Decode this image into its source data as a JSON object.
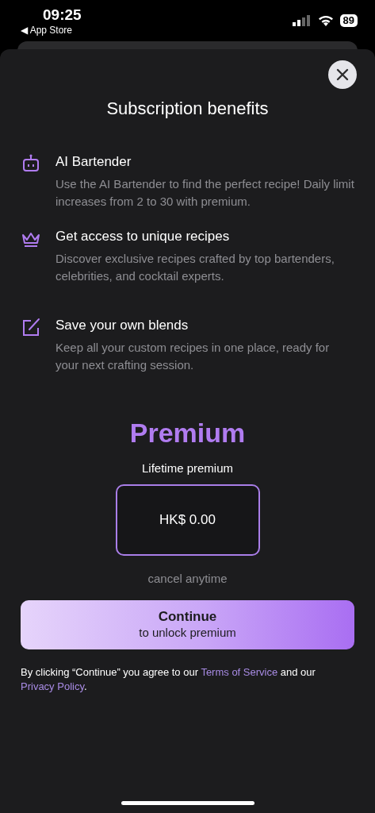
{
  "status_bar": {
    "time": "09:25",
    "back_label": "◀ App Store",
    "battery": "89"
  },
  "title": "Subscription benefits",
  "benefits": [
    {
      "kind": "robot",
      "title": "AI Bartender",
      "description": "Use the AI Bartender to find the perfect recipe! Daily limit increases from 2 to 30 with premium."
    },
    {
      "kind": "crown",
      "title": "Get access to unique recipes",
      "description": "Discover exclusive recipes crafted by top bartenders, celebrities, and cocktail experts."
    },
    {
      "kind": "edit",
      "title": "Save your own blends",
      "description": "Keep all your custom recipes in one place, ready for your next crafting session."
    }
  ],
  "plan": {
    "heading": "Premium",
    "name": "Lifetime premium",
    "price": "HK$ 0.00",
    "selected": true,
    "note": "cancel anytime"
  },
  "continue_button": {
    "title": "Continue",
    "subtitle": "to unlock premium"
  },
  "legal": {
    "before": "By clicking “Continue” you agree to our ",
    "terms": "Terms of Service",
    "middle": " and our ",
    "privacy": "Privacy Policy",
    "after": "."
  }
}
